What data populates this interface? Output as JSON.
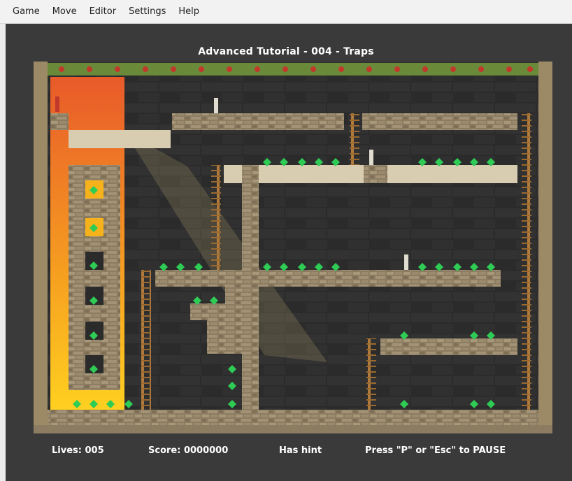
{
  "menu": {
    "items": [
      {
        "label": "Game"
      },
      {
        "label": "Move"
      },
      {
        "label": "Editor"
      },
      {
        "label": "Settings"
      },
      {
        "label": "Help"
      }
    ]
  },
  "level": {
    "title": "Advanced Tutorial - 004 - Traps"
  },
  "status": {
    "lives": "Lives: 005",
    "score": "Score: 0000000",
    "hint": "Has hint",
    "pause": "Press \"P\" or \"Esc\" to PAUSE"
  },
  "colors": {
    "background": "#3a3a3a",
    "sunset": "#f07a2a",
    "brick": "#8a7a60",
    "ladder": "#a0703a",
    "gem": "#2ecc55"
  }
}
